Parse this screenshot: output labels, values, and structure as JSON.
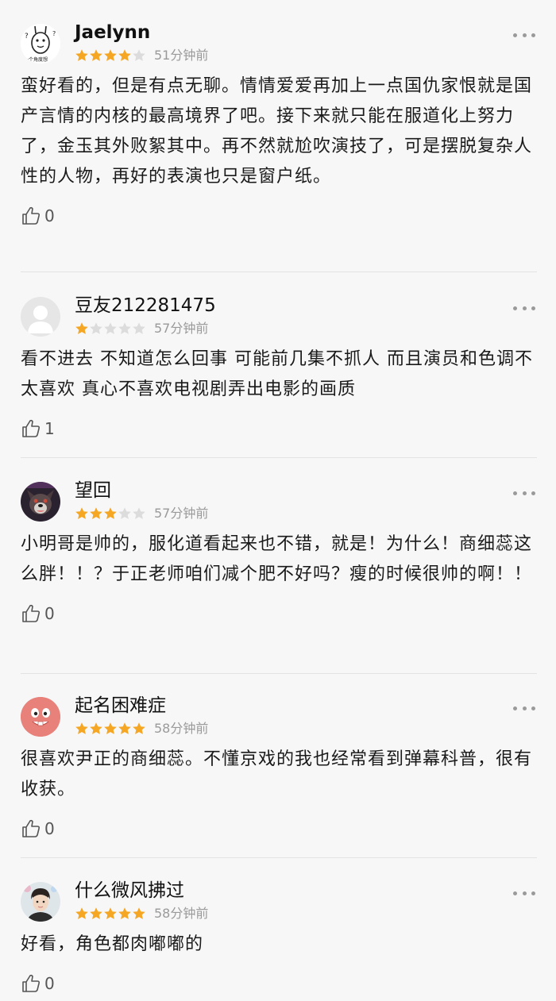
{
  "colors": {
    "star_filled": "#f5a623",
    "star_empty": "#dcdcdc",
    "background": "#f7f7f7",
    "muted_text": "#9a9a9a"
  },
  "reviews": [
    {
      "username": "Jaelynn",
      "avatar_icon": "doodle-bunny-avatar",
      "avatar_caption": "一个角度想",
      "rating": 4,
      "time": "51分钟前",
      "content": "蛮好看的，但是有点无聊。情情爱爱再加上一点国仇家恨就是国产言情的内核的最高境界了吧。接下来就只能在服道化上努力了，金玉其外败絮其中。再不然就尬吹演技了，可是摆脱复杂人性的人物，再好的表演也只是窗户纸。",
      "likes": "0"
    },
    {
      "username": "豆友212281475",
      "avatar_icon": "default-user-avatar",
      "rating": 1,
      "time": "57分钟前",
      "content": "看不进去 不知道怎么回事 可能前几集不抓人 而且演员和色调不太喜欢 真心不喜欢电视剧弄出电影的画质",
      "likes": "1"
    },
    {
      "username": "望回",
      "avatar_icon": "dog-photo-avatar",
      "rating": 3,
      "time": "57分钟前",
      "content": "小明哥是帅的，服化道看起来也不错，就是！为什么！商细蕊这么胖！！？于正老师咱们减个肥不好吗？瘦的时候很帅的啊！！",
      "likes": "0"
    },
    {
      "username": "起名困难症",
      "avatar_icon": "cartoon-face-avatar",
      "rating": 5,
      "time": "58分钟前",
      "content": "很喜欢尹正的商细蕊。不懂京戏的我也经常看到弹幕科普，很有收获。",
      "likes": "0"
    },
    {
      "username": "什么微风拂过",
      "avatar_icon": "person-photo-avatar",
      "rating": 5,
      "time": "58分钟前",
      "content": "好看，角色都肉嘟嘟的",
      "likes": "0"
    }
  ]
}
